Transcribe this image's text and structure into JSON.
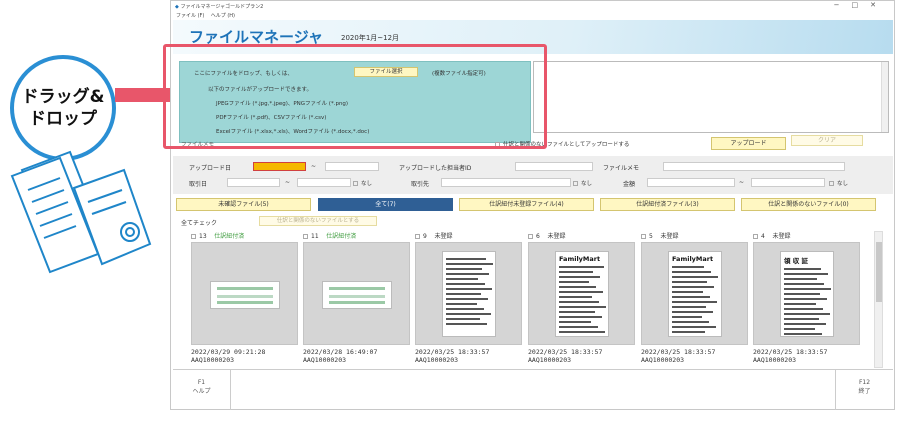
{
  "illustration": {
    "callout_line1": "ドラッグ&",
    "callout_line2": "ドロップ"
  },
  "window": {
    "title": "ファイルマネージャゴールドプラン2",
    "menu": [
      "ファイル (F)",
      "ヘルプ (H)"
    ],
    "controls": [
      "−",
      "□",
      "✕"
    ]
  },
  "banner": {
    "title": "ファイルマネージャ",
    "range": "2020年1月~12月"
  },
  "drop": {
    "prompt": "ここにファイルをドロップ、もしくは、",
    "select_button": "ファイル選択",
    "multi_note": "(複数ファイル指定可)",
    "allowed_heading": "以下のファイルがアップロードできます。",
    "types": [
      "JPEGファイル (*.jpg,*.jpeg)、PNGファイル (*.png)",
      "PDFファイル (*.pdf)、CSVファイル (*.csv)",
      "Excelファイル (*.xlsx,*.xls)、Wordファイル (*.docx,*.doc)"
    ]
  },
  "memo_label": "ファイルメモ",
  "upload_unrelated_label": "仕訳と関係のないファイルとしてアップロードする",
  "upload_button": "アップロード",
  "clear_button": "クリア",
  "filters": {
    "upload_date": "アップロード日",
    "tilde": "~",
    "uploader": "アップロードした担当者ID",
    "file_memo": "ファイルメモ",
    "txn_date": "取引日",
    "partner": "取引先",
    "amount": "金額",
    "none": "なし"
  },
  "tabs": [
    "未確認ファイル(5)",
    "全て(7)",
    "仕訳紐付未登録ファイル(4)",
    "仕訳紐付済ファイル(3)",
    "仕訳と関係のないファイル(0)"
  ],
  "check_all": "全てチェック",
  "unrelated_button": "仕訳と関係のないファイルとする",
  "cards": [
    {
      "num": "13",
      "status": "仕訳紐付済",
      "date": "2022/03/29 09:21:28",
      "id": "AAQ10000203",
      "kind": "slip"
    },
    {
      "num": "11",
      "status": "仕訳紐付済",
      "date": "2022/03/28 16:49:07",
      "id": "AAQ10000203",
      "kind": "slip"
    },
    {
      "num": "9",
      "status": "未登録",
      "date": "2022/03/25 18:33:57",
      "id": "AAQ10000203",
      "kind": "receipt",
      "logo": ""
    },
    {
      "num": "6",
      "status": "未登録",
      "date": "2022/03/25 18:33:57",
      "id": "AAQ10000203",
      "kind": "receipt",
      "logo": "FamilyMart"
    },
    {
      "num": "5",
      "status": "未登録",
      "date": "2022/03/25 18:33:57",
      "id": "AAQ10000203",
      "kind": "receipt",
      "logo": "FamilyMart"
    },
    {
      "num": "4",
      "status": "未登録",
      "date": "2022/03/25 18:33:57",
      "id": "AAQ10000203",
      "kind": "receipt",
      "logo": "領 収 証"
    }
  ],
  "footer": {
    "f1_key": "F1",
    "f1_label": "ヘルプ",
    "f12_key": "F12",
    "f12_label": "終了"
  },
  "colors": {
    "accent": "#e8566a",
    "brand": "#1e73b8",
    "drop_bg": "#9dd6d6",
    "tab_active": "#2f5f95",
    "button_bg": "#fff7c2"
  }
}
